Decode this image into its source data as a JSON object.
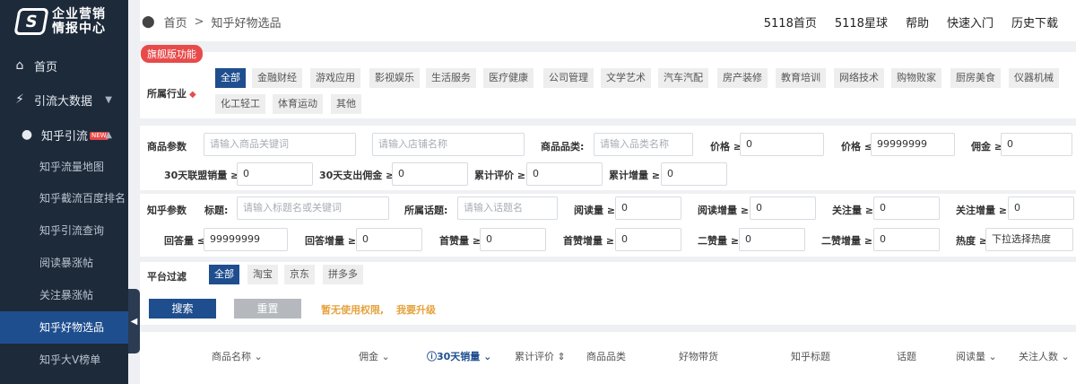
{
  "brand": {
    "logo_mark": "S",
    "line1": "企业营销",
    "line2": "情报中心"
  },
  "sidebar": {
    "home": "首页",
    "traffic": "引流大数据",
    "zhihu": "知乎引流",
    "new_badge": "NEW",
    "sub_items": [
      "知乎流量地图",
      "知乎截流百度排名",
      "知乎引流查询",
      "阅读暴涨帖",
      "关注暴涨帖",
      "知乎好物选品",
      "知乎大V榜单"
    ]
  },
  "breadcrumb": {
    "home": "首页",
    "sep": ">",
    "current": "知乎好物选品"
  },
  "top_links": [
    "5118首页",
    "5118星球",
    "帮助",
    "快速入门",
    "历史下载"
  ],
  "industry": {
    "badge": "旗舰版功能",
    "label": "所属行业",
    "tags": [
      "全部",
      "金融财经",
      "游戏应用",
      "影视娱乐",
      "生活服务",
      "医疗健康",
      "公司管理",
      "文学艺术",
      "汽车汽配",
      "房产装修",
      "教育培训",
      "网络技术",
      "购物败家",
      "厨房美食",
      "仪器机械",
      "化工轻工",
      "体育运动",
      "其他"
    ]
  },
  "product": {
    "section": "商品参数",
    "name_ph": "请输入商品关键词",
    "shop_ph": "请输入店铺名称",
    "category_label": "商品品类:",
    "category_ph": "请输入品类名称",
    "price_min_label": "价格 ≥",
    "price_min": "0",
    "price_max_label": "价格 ≤",
    "price_max": "99999999",
    "commission_label": "佣金 ≥",
    "commission": "0",
    "sales30_label": "30天联盟销量 ≥",
    "sales30": "0",
    "spend30_label": "30天支出佣金 ≥",
    "spend30": "0",
    "reviews_label": "累计评价 ≥",
    "reviews": "0",
    "reviews_inc_label": "累计增量 ≥",
    "reviews_inc": "0"
  },
  "zhihu_params": {
    "section": "知乎参数",
    "title_label": "标题:",
    "title_ph": "请输入标题名或关键词",
    "topic_label": "所属话题:",
    "topic_ph": "请输入话题名",
    "reads_label": "阅读量 ≥",
    "reads": "0",
    "reads_inc_label": "阅读增量 ≥",
    "reads_inc": "0",
    "follows_label": "关注量 ≥",
    "follows": "0",
    "follows_inc_label": "关注增量 ≥",
    "follows_inc": "0",
    "answers_label": "回答量 ≤",
    "answers": "99999999",
    "answers_inc_label": "回答增量 ≥",
    "answers_inc": "0",
    "likes_label": "首赞量 ≥",
    "likes": "0",
    "likes_inc_label": "首赞增量 ≥",
    "likes_inc": "0",
    "second_label": "二赞量 ≥",
    "second": "0",
    "second_inc_label": "二赞增量 ≥",
    "second_inc": "0",
    "heat_label": "热度 ≥",
    "heat_ph": "下拉选择热度"
  },
  "platform": {
    "label": "平台过滤",
    "tags": [
      "全部",
      "淘宝",
      "京东",
      "拼多多"
    ]
  },
  "actions": {
    "search": "搜索",
    "reset": "重置",
    "no_auth": "暂无使用权限,",
    "upgrade": "我要升级"
  },
  "table": {
    "headers": [
      "商品名称",
      "佣金",
      "30天销量",
      "累计评价",
      "商品品类",
      "好物带货",
      "知乎标题",
      "话题",
      "阅读量",
      "关注人数"
    ]
  },
  "colors": {
    "sidebar": "#1d2a3a",
    "accent": "#1f4e8f",
    "badge": "#e84a4a",
    "warning": "#e6a23c"
  }
}
